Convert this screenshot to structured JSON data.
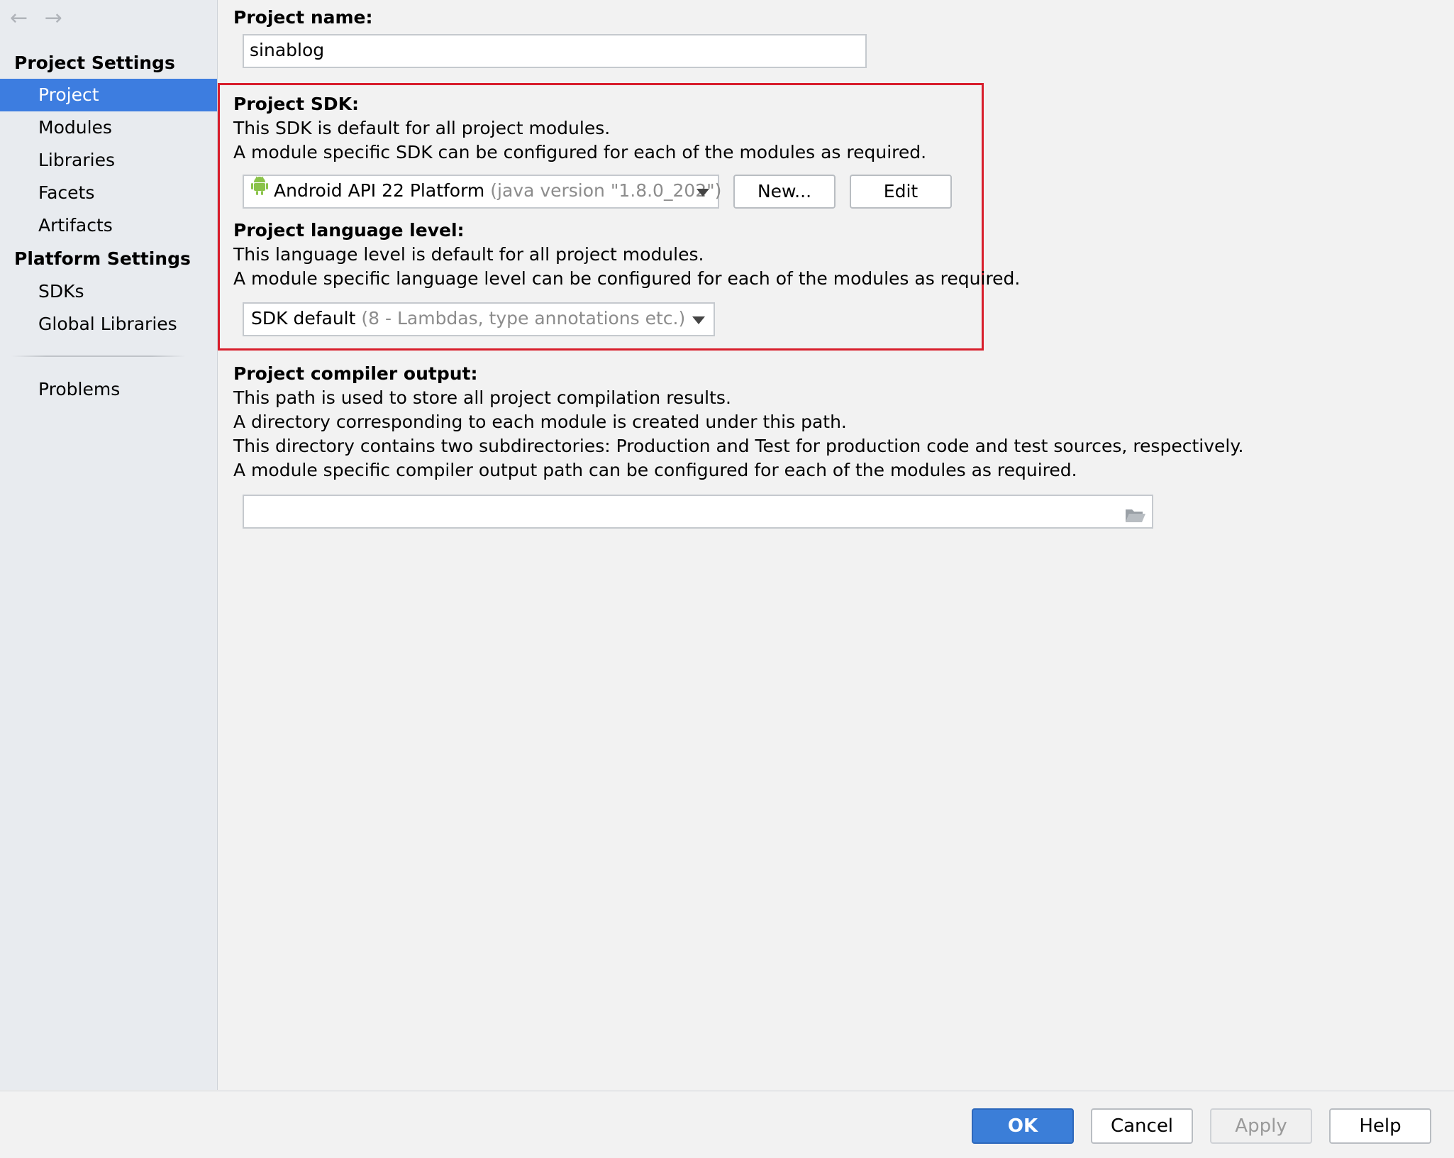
{
  "sidebar": {
    "back_arrow": "←",
    "forward_arrow": "→",
    "project_settings_header": "Project Settings",
    "project_items": [
      "Project",
      "Modules",
      "Libraries",
      "Facets",
      "Artifacts"
    ],
    "platform_settings_header": "Platform Settings",
    "platform_items": [
      "SDKs",
      "Global Libraries"
    ],
    "problems": "Problems",
    "selected_item": "Project"
  },
  "main": {
    "project_name_label": "Project name:",
    "project_name_value": "sinablog",
    "sdk": {
      "label": "Project SDK:",
      "desc1": "This SDK is default for all project modules.",
      "desc2": "A module specific SDK can be configured for each of the modules as required.",
      "selected": "Android API 22 Platform",
      "selected_detail": "(java version \"1.8.0_202\")",
      "new_button": "New...",
      "edit_button": "Edit"
    },
    "language_level": {
      "label": "Project language level:",
      "desc1": "This language level is default for all project modules.",
      "desc2": "A module specific language level can be configured for each of the modules as required.",
      "selected": "SDK default",
      "selected_detail": "(8 - Lambdas, type annotations etc.)"
    },
    "compiler_output": {
      "label": "Project compiler output:",
      "desc1": "This path is used to store all project compilation results.",
      "desc2": "A directory corresponding to each module is created under this path.",
      "desc3": "This directory contains two subdirectories: Production and Test for production code and test sources, respectively.",
      "desc4": "A module specific compiler output path can be configured for each of the modules as required.",
      "path_value": ""
    }
  },
  "footer": {
    "ok": "OK",
    "cancel": "Cancel",
    "apply": "Apply",
    "help": "Help"
  },
  "colors": {
    "selection": "#3d7de0",
    "highlight_border": "#d81e2c",
    "primary_button": "#3b7ed8",
    "android_green": "#8bc34a"
  }
}
